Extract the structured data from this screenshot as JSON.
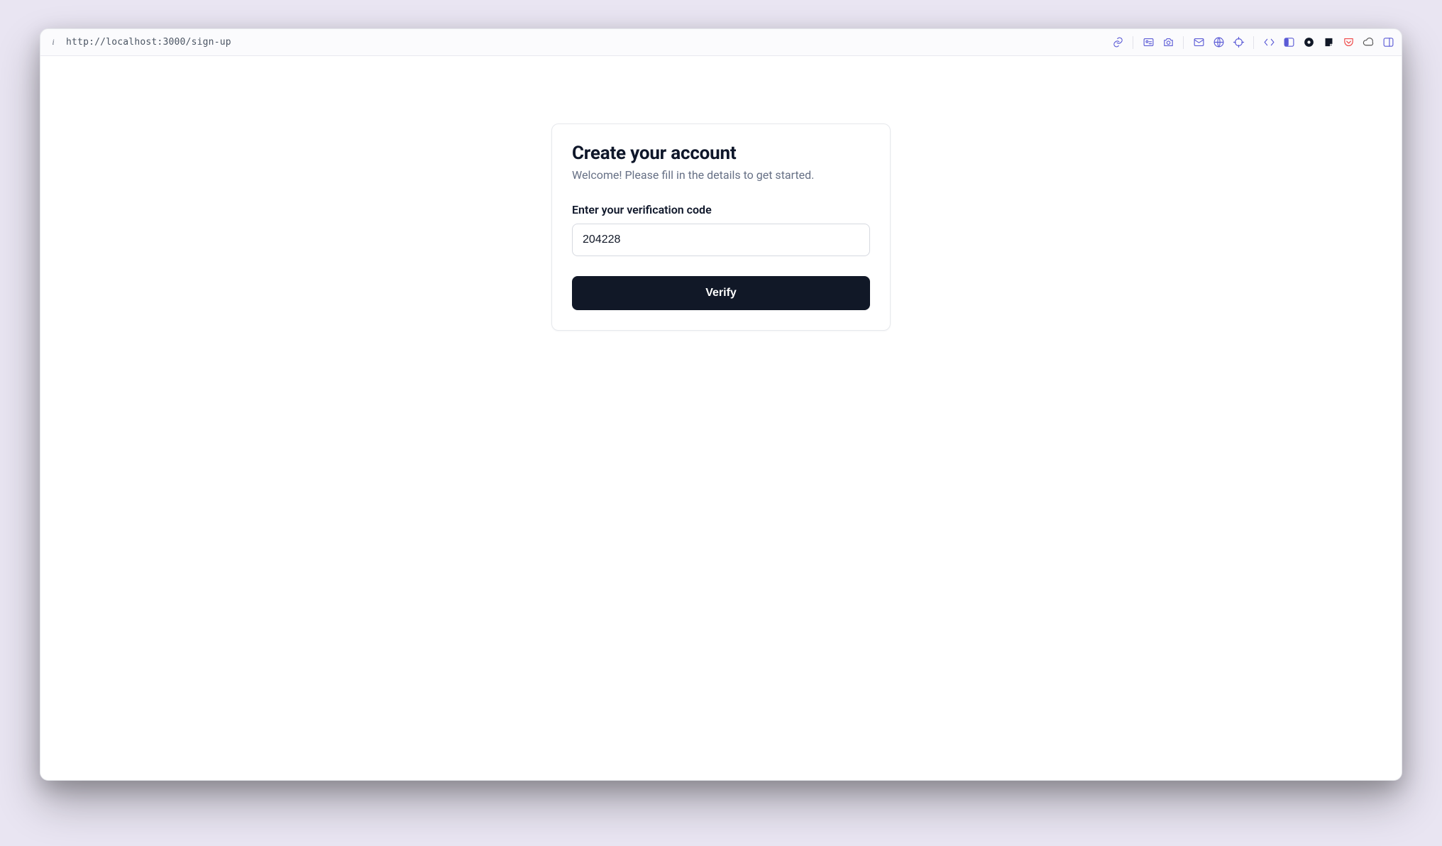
{
  "browser": {
    "url": "http://localhost:3000/sign-up",
    "icons": [
      "link-icon",
      "sep",
      "id-card-icon",
      "camera-icon",
      "sep",
      "mail-icon",
      "globe-icon",
      "crosshair-icon",
      "sep",
      "chevrons-icon",
      "sidebar-left-icon",
      "circle-dot-icon",
      "sticky-note-icon",
      "pocket-icon",
      "cloud-icon",
      "panel-icon"
    ]
  },
  "card": {
    "title": "Create your account",
    "subtitle": "Welcome! Please fill in the details to get started.",
    "code_label": "Enter your verification code",
    "code_value": "204228",
    "verify_label": "Verify"
  }
}
